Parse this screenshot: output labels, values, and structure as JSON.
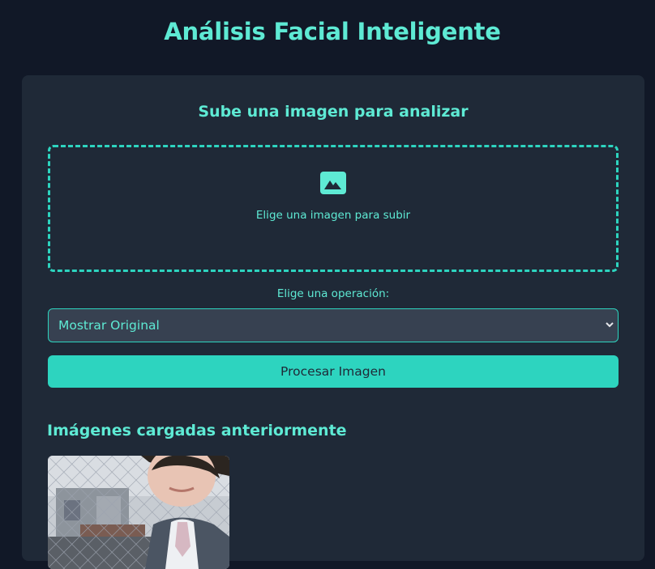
{
  "header": {
    "title": "Análisis Facial Inteligente"
  },
  "upload": {
    "heading": "Sube una imagen para analizar",
    "dropzone_text": "Elige una imagen para subir",
    "icon": "image-icon"
  },
  "operation": {
    "label": "Elige una operación:",
    "selected": "Mostrar Original"
  },
  "actions": {
    "process_label": "Procesar Imagen"
  },
  "history": {
    "heading": "Imágenes cargadas anteriormente",
    "items": [
      {
        "alt": "thumbnail"
      }
    ]
  },
  "colors": {
    "background": "#111827",
    "card": "#1f2937",
    "accent": "#2dd4bf",
    "accent_text": "#5eead4",
    "select_bg": "#374151"
  }
}
